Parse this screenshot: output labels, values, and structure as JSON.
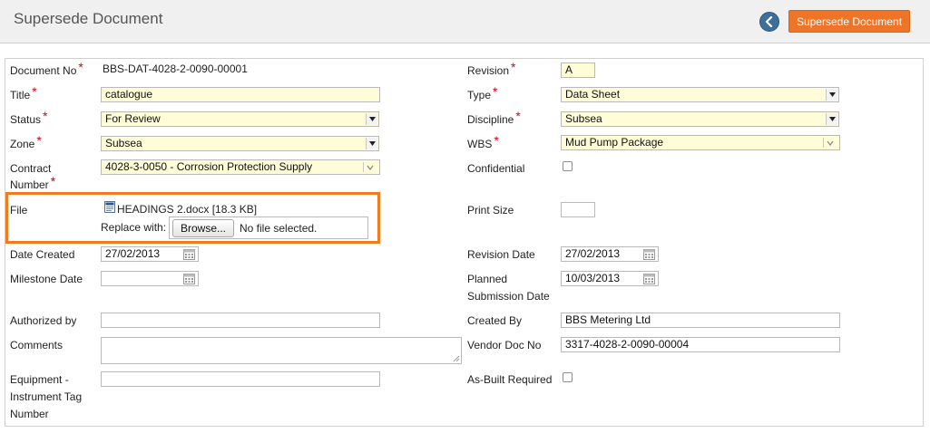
{
  "header": {
    "title": "Supersede Document",
    "action_label": "Supersede Document"
  },
  "left": {
    "document_no": {
      "label": "Document No",
      "value": "BBS-DAT-4028-2-0090-00001"
    },
    "title": {
      "label": "Title",
      "value": "catalogue"
    },
    "status": {
      "label": "Status",
      "value": "For Review"
    },
    "zone": {
      "label": "Zone",
      "value": "Subsea"
    },
    "contract_number": {
      "label_line1": "Contract",
      "label_line2": "Number",
      "value": "4028-3-0050 - Corrosion Protection Supply"
    },
    "file": {
      "label": "File",
      "file_name": "HEADINGS 2.docx [18.3 KB]",
      "replace_label": "Replace with:",
      "browse_label": "Browse...",
      "no_file_text": "No file selected."
    },
    "date_created": {
      "label": "Date Created",
      "value": "27/02/2013"
    },
    "milestone_date": {
      "label": "Milestone Date",
      "value": ""
    },
    "authorized_by": {
      "label": "Authorized by",
      "value": ""
    },
    "comments": {
      "label": "Comments",
      "value": ""
    },
    "equipment_tag": {
      "label_line1": "Equipment -",
      "label_line2": "Instrument Tag",
      "label_line3": "Number",
      "value": ""
    }
  },
  "right": {
    "revision": {
      "label": "Revision",
      "value": "A"
    },
    "type": {
      "label": "Type",
      "value": "Data Sheet"
    },
    "discipline": {
      "label": "Discipline",
      "value": "Subsea"
    },
    "wbs": {
      "label": "WBS",
      "value": "Mud Pump Package"
    },
    "confidential": {
      "label": "Confidential",
      "checked": false
    },
    "print_size": {
      "label": "Print Size",
      "value": ""
    },
    "revision_date": {
      "label": "Revision Date",
      "value": "27/02/2013"
    },
    "planned_submission_date": {
      "label_line1": "Planned",
      "label_line2": "Submission Date",
      "value": "10/03/2013"
    },
    "created_by": {
      "label": "Created By",
      "value": "BBS Metering Ltd"
    },
    "vendor_doc_no": {
      "label": "Vendor Doc No",
      "value": "3317-4028-2-0090-00004"
    },
    "as_built_required": {
      "label": "As-Built Required",
      "checked": false
    }
  },
  "required_marker": "*",
  "colors": {
    "accent": "#ee7428",
    "highlight_border": "#ef7d1c",
    "required": "#d0021b",
    "input_yellow": "#fefdd7",
    "back_button": "#3f6e99"
  }
}
